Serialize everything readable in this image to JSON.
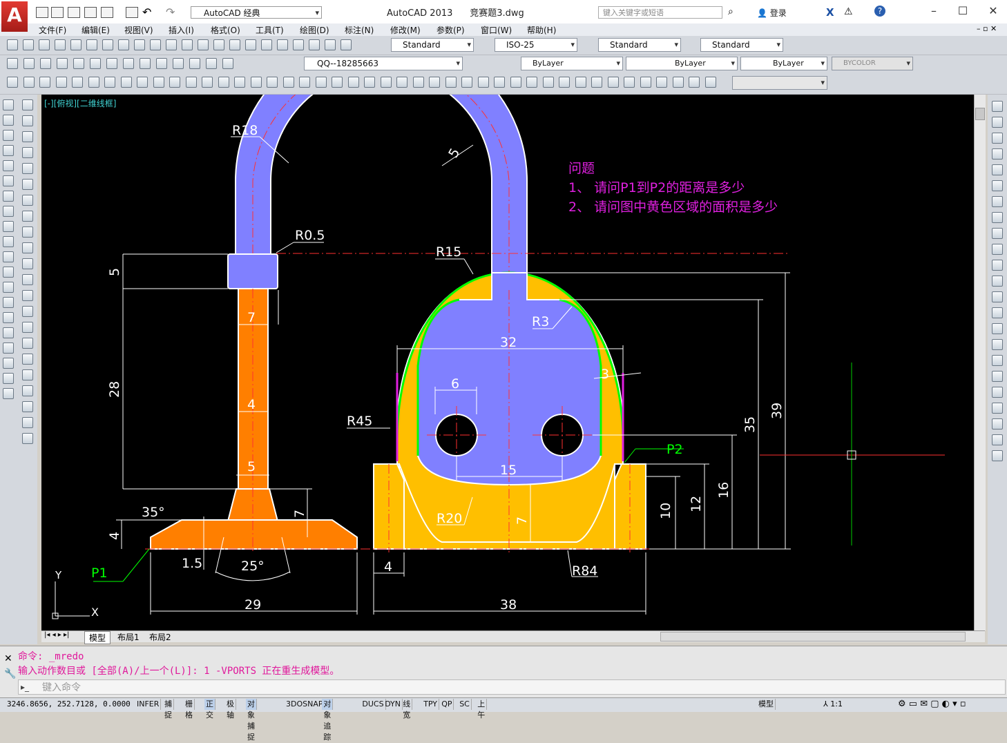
{
  "app": {
    "title": "AutoCAD 2013",
    "document": "竞赛题3.dwg",
    "workspace": "AutoCAD 经典",
    "search_placeholder": "键入关键字或短语",
    "login": "登录"
  },
  "menu": [
    "文件(F)",
    "编辑(E)",
    "视图(V)",
    "插入(I)",
    "格式(O)",
    "工具(T)",
    "绘图(D)",
    "标注(N)",
    "修改(M)",
    "参数(P)",
    "窗口(W)",
    "帮助(H)"
  ],
  "styles": {
    "text_style": "Standard",
    "dim_style": "ISO-25",
    "table_style": "Standard",
    "mleader_style": "Standard"
  },
  "layers": {
    "current_layer": "QQ--18285663",
    "color": "ByLayer",
    "linetype": "ByLayer",
    "lineweight": "ByLayer",
    "plotstyle": "BYCOLOR"
  },
  "viewport_label": "[-][俯视][二维线框]",
  "drawing": {
    "question_title": "问题",
    "question_1": "1、 请问P1到P2的距离是多少",
    "question_2": "2、 请问图中黄色区域的面积是多少",
    "dims": {
      "r18": "R18",
      "r05": "R0.5",
      "r15": "R15",
      "r3": "R3",
      "r45": "R45",
      "r20": "R20",
      "r84": "R84",
      "d5_top": "5",
      "d5_arc": "5",
      "d7_neck": "7",
      "d28": "28",
      "d4_col": "4",
      "d5_col": "5",
      "d7_base": "7",
      "d35deg": "35°",
      "d4_base": "4",
      "d15": "1.5",
      "d25deg": "25°",
      "d29": "29",
      "d32": "32",
      "d3": "3",
      "d6": "6",
      "d15b": "15",
      "d7b": "7",
      "d4b": "4",
      "d38": "38",
      "d10": "10",
      "d12": "12",
      "d16": "16",
      "d35": "35",
      "d39": "39"
    },
    "p1": "P1",
    "p2": "P2",
    "ucs_x": "X",
    "ucs_y": "Y",
    "colors": {
      "purple": "#8080ff",
      "orange": "#ff7f00",
      "yellow": "#ffbf00",
      "green": "#00ff00",
      "magenta": "#e020e0",
      "red": "#ff0000"
    }
  },
  "layout_tabs": [
    "模型",
    "布局1",
    "布局2"
  ],
  "command": {
    "line1": "命令: _mredo",
    "line2": "输入动作数目或 [全部(A)/上一个(L)]: 1 -VPORTS 正在重生成模型。",
    "prompt": "键入命令"
  },
  "status": {
    "coords": "3246.8656, 252.7128, 0.0000",
    "toggles": [
      "INFER",
      "捕捉",
      "栅格",
      "正交",
      "极轴",
      "对象捕捉",
      "3DOSNAP",
      "对象追踪",
      "DUCS",
      "DYN",
      "线宽",
      "TPY",
      "QP",
      "SC",
      "上午"
    ],
    "model_label": "模型",
    "scale": "1:1"
  }
}
